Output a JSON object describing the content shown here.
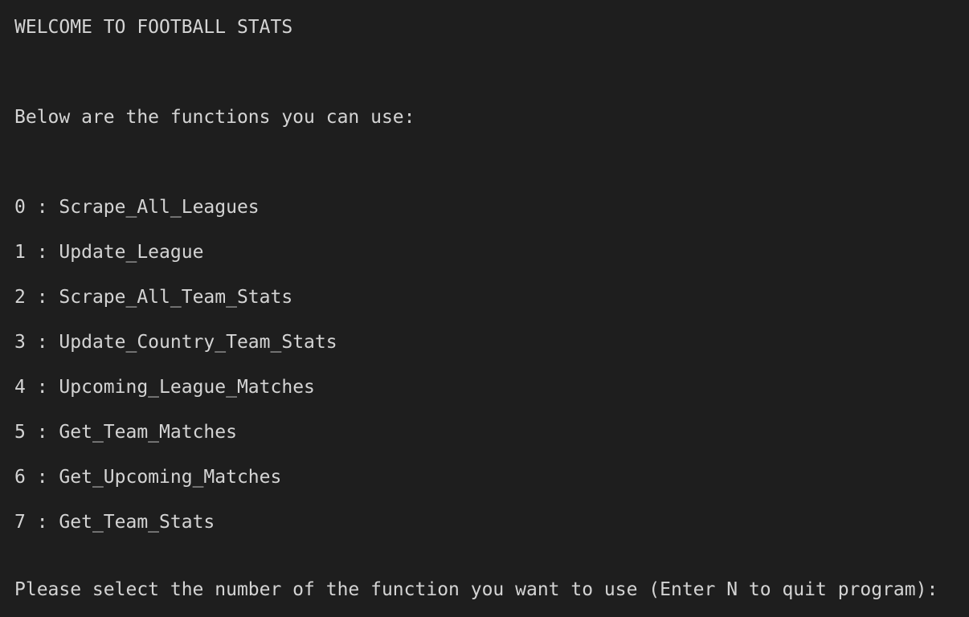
{
  "terminal": {
    "title": "WELCOME TO FOOTBALL STATS",
    "intro": "Below are the functions you can use:",
    "functions": [
      {
        "number": "0",
        "separator": " : ",
        "name": "Scrape_All_Leagues"
      },
      {
        "number": "1",
        "separator": " : ",
        "name": "Update_League"
      },
      {
        "number": "2",
        "separator": " : ",
        "name": "Scrape_All_Team_Stats"
      },
      {
        "number": "3",
        "separator": " : ",
        "name": "Update_Country_Team_Stats"
      },
      {
        "number": "4",
        "separator": " : ",
        "name": "Upcoming_League_Matches"
      },
      {
        "number": "5",
        "separator": " : ",
        "name": "Get_Team_Matches"
      },
      {
        "number": "6",
        "separator": " : ",
        "name": "Get_Upcoming_Matches"
      },
      {
        "number": "7",
        "separator": " : ",
        "name": "Get_Team_Stats"
      }
    ],
    "prompt": "Please select the number of the function you want to use (Enter N to quit program):"
  }
}
